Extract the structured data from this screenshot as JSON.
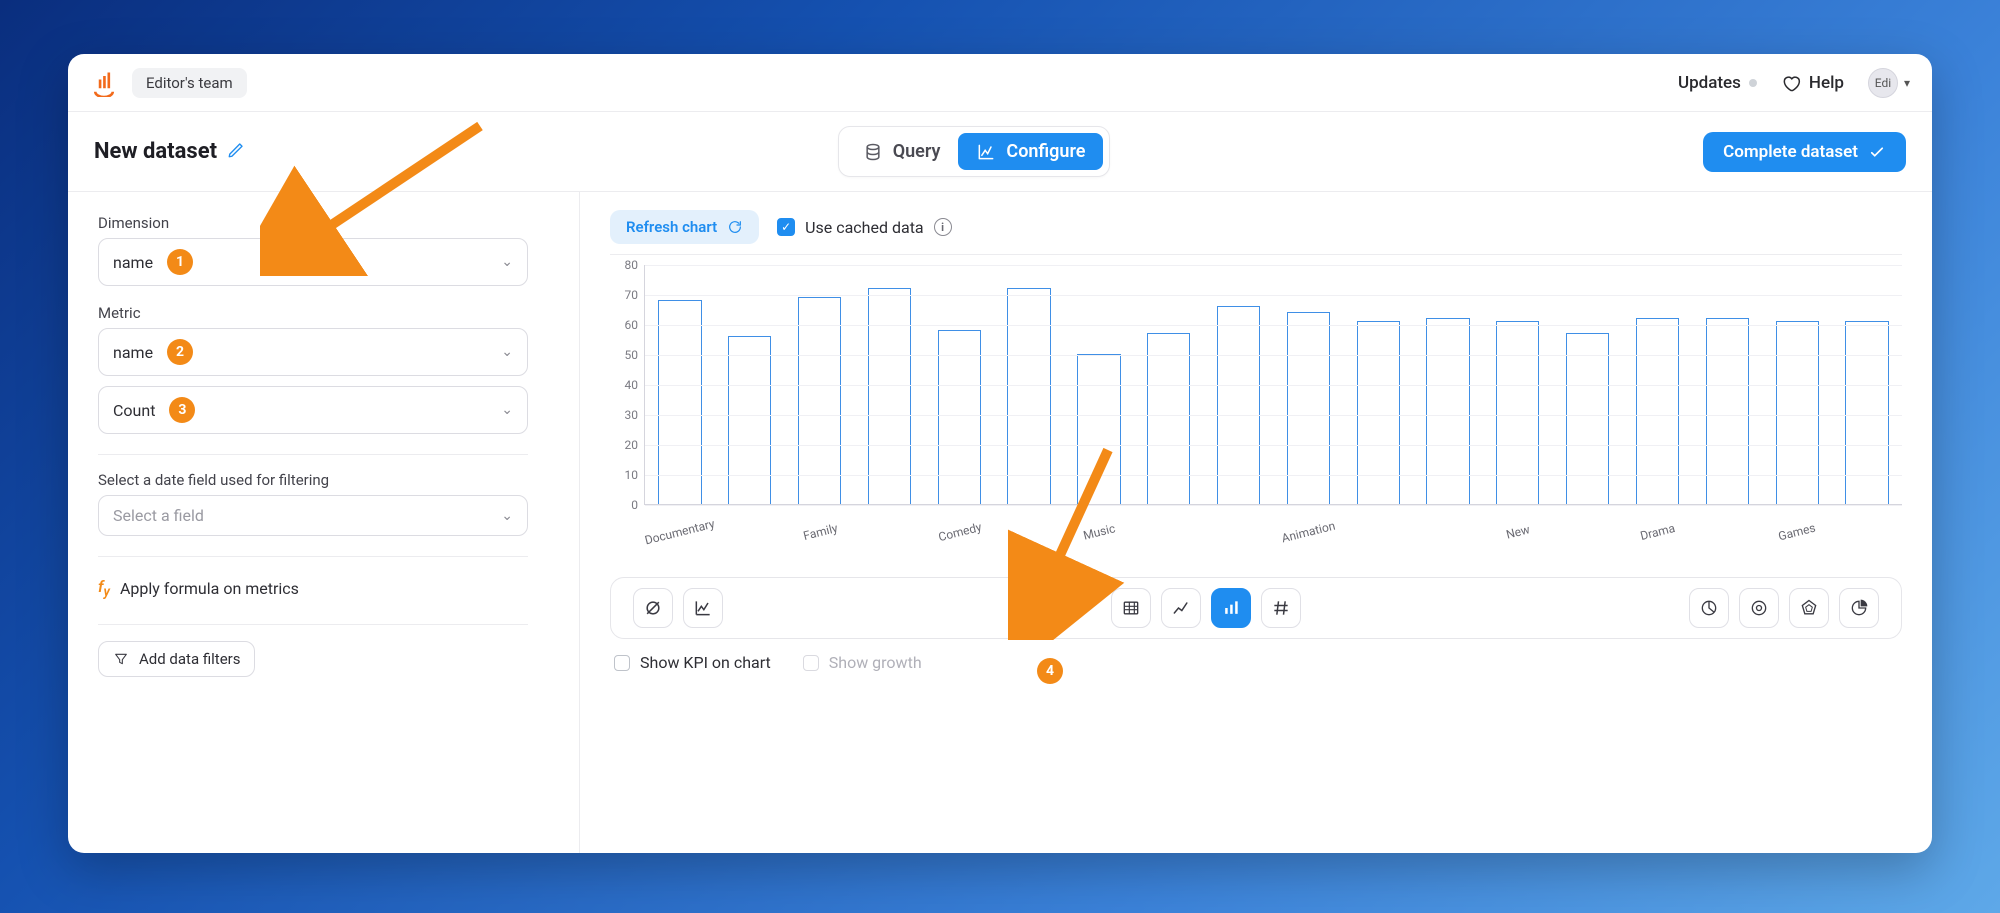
{
  "header": {
    "team": "Editor's team",
    "updates": "Updates",
    "help": "Help",
    "user_short": "Edi"
  },
  "subheader": {
    "title": "New dataset",
    "tabs": {
      "query": "Query",
      "configure": "Configure"
    },
    "complete": "Complete dataset"
  },
  "left": {
    "dimension_label": "Dimension",
    "dimension_value": "name",
    "metric_label": "Metric",
    "metric_value": "name",
    "aggregate_value": "Count",
    "date_filter_label": "Select a date field used for filtering",
    "date_placeholder": "Select a field",
    "formula_label": "Apply formula on metrics",
    "add_filters": "Add data filters",
    "badges": {
      "one": "1",
      "two": "2",
      "three": "3"
    }
  },
  "right": {
    "refresh": "Refresh chart",
    "cached": "Use cached data",
    "kpi": "Show KPI on chart",
    "growth": "Show growth"
  },
  "annotation_four": "4",
  "chart_data": {
    "type": "bar",
    "title": "",
    "xlabel": "",
    "ylabel": "",
    "ylim": [
      0,
      80
    ],
    "yticks": [
      0,
      10,
      20,
      30,
      40,
      50,
      60,
      70,
      80
    ],
    "categories": [
      "Documentary",
      "",
      "Family",
      "",
      "Comedy",
      "",
      "Music",
      "",
      "",
      "Animation",
      "",
      "",
      "New",
      "",
      "Drama",
      "",
      "Games",
      ""
    ],
    "values": [
      68,
      56,
      69,
      72,
      58,
      72,
      50,
      57,
      66,
      64,
      61,
      62,
      61,
      57,
      62,
      62,
      61,
      61
    ]
  }
}
